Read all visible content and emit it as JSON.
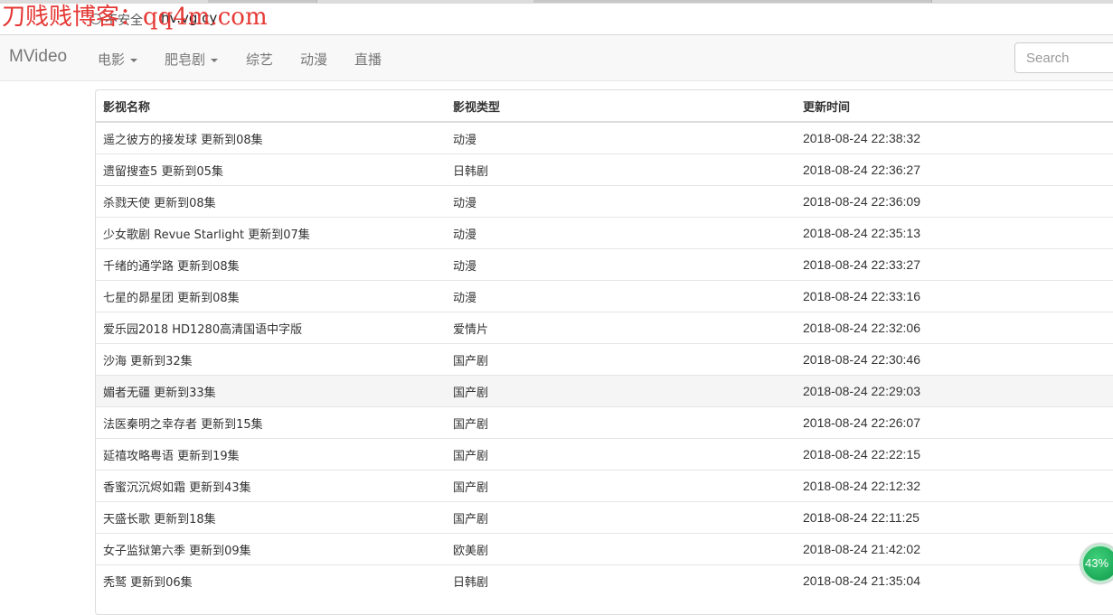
{
  "browser": {
    "security_label": "不安全",
    "url": "hv.vg.cy"
  },
  "watermark": "刀贱贱博客：qq4m.com",
  "navbar": {
    "brand": "MVideo",
    "items": [
      {
        "label": "电影",
        "dropdown": true
      },
      {
        "label": "肥皂剧",
        "dropdown": true
      },
      {
        "label": "综艺",
        "dropdown": false
      },
      {
        "label": "动漫",
        "dropdown": false
      },
      {
        "label": "直播",
        "dropdown": false
      }
    ],
    "search_placeholder": "Search"
  },
  "table": {
    "headers": [
      "影视名称",
      "影视类型",
      "更新时间"
    ],
    "rows": [
      [
        "遥之彼方的接发球 更新到08集",
        "动漫",
        "2018-08-24 22:38:32"
      ],
      [
        "遗留搜查5 更新到05集",
        "日韩剧",
        "2018-08-24 22:36:27"
      ],
      [
        "杀戮天使 更新到08集",
        "动漫",
        "2018-08-24 22:36:09"
      ],
      [
        "少女歌剧 Revue Starlight 更新到07集",
        "动漫",
        "2018-08-24 22:35:13"
      ],
      [
        "千绪的通学路 更新到08集",
        "动漫",
        "2018-08-24 22:33:27"
      ],
      [
        "七星的昴星团 更新到08集",
        "动漫",
        "2018-08-24 22:33:16"
      ],
      [
        "爱乐园2018 HD1280高清国语中字版",
        "爱情片",
        "2018-08-24 22:32:06"
      ],
      [
        "沙海 更新到32集",
        "国产剧",
        "2018-08-24 22:30:46"
      ],
      [
        "媚者无疆 更新到33集",
        "国产剧",
        "2018-08-24 22:29:03"
      ],
      [
        "法医秦明之幸存者 更新到15集",
        "国产剧",
        "2018-08-24 22:26:07"
      ],
      [
        "延禧攻略粤语 更新到19集",
        "国产剧",
        "2018-08-24 22:22:15"
      ],
      [
        "香蜜沉沉烬如霜 更新到43集",
        "国产剧",
        "2018-08-24 22:12:32"
      ],
      [
        "天盛长歌 更新到18集",
        "国产剧",
        "2018-08-24 22:11:25"
      ],
      [
        "女子监狱第六季 更新到09集",
        "欧美剧",
        "2018-08-24 21:42:02"
      ],
      [
        "秃鹫 更新到06集",
        "日韩剧",
        "2018-08-24 21:35:04"
      ]
    ],
    "hover_row_index": 8
  },
  "progress_badge": "43%"
}
